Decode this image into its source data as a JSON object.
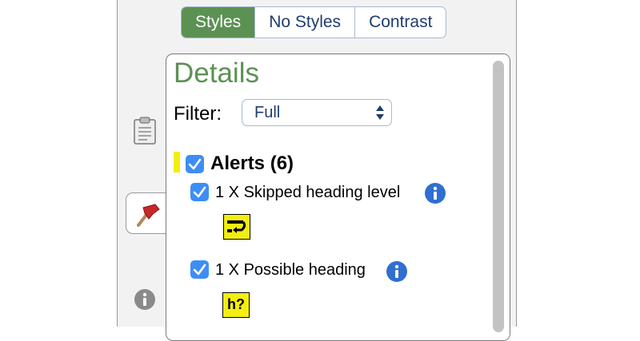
{
  "view_toggle": {
    "buttons": [
      "Styles",
      "No Styles",
      "Contrast"
    ],
    "selected": "Styles"
  },
  "side_tabs": {
    "icons": [
      "clipboard-icon",
      "alert-flag-icon",
      "info-icon"
    ],
    "selected": "alert-flag-icon"
  },
  "details": {
    "title": "Details",
    "filter_label": "Filter:",
    "filter_value": "Full",
    "alerts": {
      "label": "Alerts (6)",
      "checked": true,
      "items": [
        {
          "label": "1 X Skipped heading level",
          "checked": true,
          "badge_icon": "skipped-heading-icon"
        },
        {
          "label": "1 X Possible heading",
          "checked": true,
          "badge_text": "h?"
        }
      ]
    }
  },
  "colors": {
    "accent_green": "#5c9154",
    "checkbox_blue": "#3d8ef4",
    "alert_yellow": "#f3ee10",
    "info_blue": "#2f6fd1"
  }
}
